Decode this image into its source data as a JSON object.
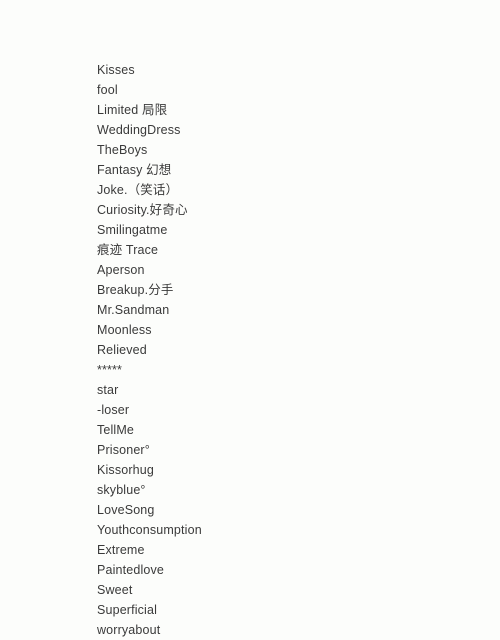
{
  "list": {
    "items": [
      {
        "label": "Kisses"
      },
      {
        "label": "fool"
      },
      {
        "label": "Limited 局限"
      },
      {
        "label": "WeddingDress"
      },
      {
        "label": "TheBoys"
      },
      {
        "label": "Fantasy 幻想"
      },
      {
        "label": "Joke.（笑话）"
      },
      {
        "label": "Curiosity.好奇心"
      },
      {
        "label": "Smilingatme"
      },
      {
        "label": "痕迹 Trace"
      },
      {
        "label": "Aperson"
      },
      {
        "label": "Breakup.分手"
      },
      {
        "label": "Mr.Sandman"
      },
      {
        "label": "Moonless"
      },
      {
        "label": "Relieved"
      },
      {
        "label": "*****"
      },
      {
        "label": "star"
      },
      {
        "label": "-loser"
      },
      {
        "label": "TellMe"
      },
      {
        "label": "Prisoner°"
      },
      {
        "label": "Kissorhug"
      },
      {
        "label": "skyblue°"
      },
      {
        "label": "LoveSong"
      },
      {
        "label": "Youthconsumption"
      },
      {
        "label": "Extreme"
      },
      {
        "label": "Paintedlove"
      },
      {
        "label": "Sweet"
      },
      {
        "label": "Superficial"
      },
      {
        "label": "worryabout"
      }
    ]
  },
  "colors": {
    "background": "#fcfdfb",
    "text": "#3a3a3a"
  }
}
